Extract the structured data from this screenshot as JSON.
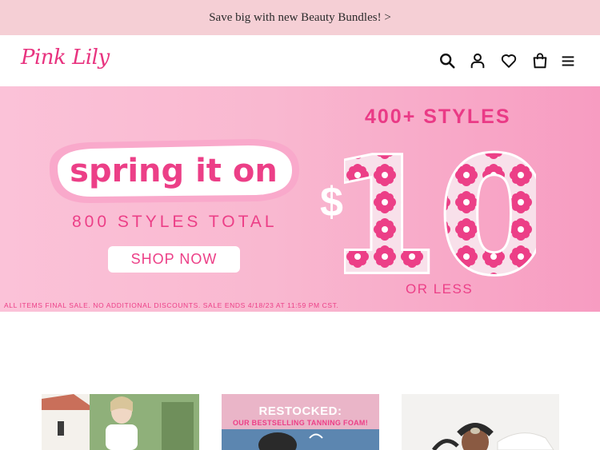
{
  "announcement": {
    "text": "Save big with new Beauty Bundles! >"
  },
  "header": {
    "logo": "Pink Lily",
    "icons": [
      "search-icon",
      "account-icon",
      "wishlist-icon",
      "cart-icon",
      "menu-icon"
    ]
  },
  "hero": {
    "headline": "spring it on",
    "styles_total": "800 STYLES TOTAL",
    "shop_button": "SHOP NOW",
    "styles_count": "400+ STYLES",
    "price_currency": "$",
    "price_value": "10",
    "price_suffix": "OR LESS",
    "fine_print": "ALL ITEMS FINAL SALE. NO ADDITIONAL DISCOUNTS. SALE ENDS 4/18/23 AT 11:59 PM CST."
  },
  "tiles": [
    {
      "title": "",
      "subtitle": ""
    },
    {
      "title": "RESTOCKED:",
      "subtitle": "OUR BESTSELLING TANNING FOAM!"
    },
    {
      "title": "",
      "subtitle": ""
    }
  ],
  "colors": {
    "brand_pink": "#ec3f87",
    "announce_bg": "#f5cfd5",
    "hero_bg": "#f9b8d0"
  }
}
